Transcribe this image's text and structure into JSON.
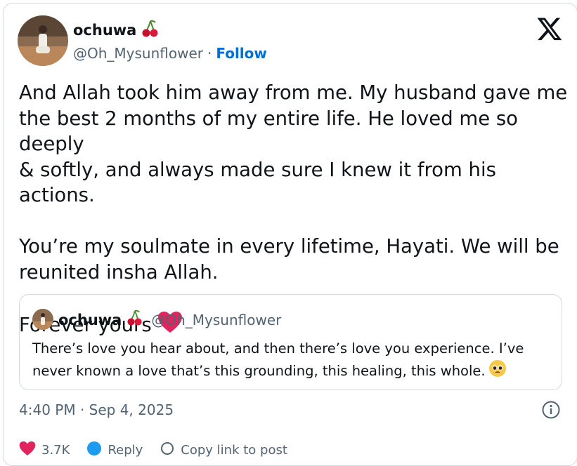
{
  "author": {
    "name": "ochuwa",
    "handle": "@Oh_Mysunflower",
    "separator": "·",
    "follow_label": "Follow",
    "badge_icon": "cherries-emoji"
  },
  "post": {
    "text": "And Allah took him away from me. My husband gave me\nthe best 2 months of my entire life. He loved me so deeply\n& softly, and always made sure I knew it from his actions.\n\nYou’re my soulmate in every lifetime, Hayati. We will be\nreunited insha Allah.\n\nForever yours",
    "heart_icon": "red-heart-emoji"
  },
  "quoted": {
    "name": "ochuwa",
    "handle": "@Oh_Mysunflower",
    "text": "There’s love you hear about, and then there’s love you experience. I’ve never known a love that’s this grounding, this healing, this whole.",
    "emoji_icon": "pleading-face-emoji"
  },
  "meta": {
    "timestamp": "4:40 PM · Sep 4, 2025"
  },
  "actions": {
    "like_count": "3.7K",
    "reply_label": "Reply",
    "copy_label": "Copy link to post"
  },
  "colors": {
    "text": "#0f1419",
    "secondary": "#536471",
    "link": "#006fd6",
    "border": "#cfd9de",
    "heart": "#e0245e"
  }
}
